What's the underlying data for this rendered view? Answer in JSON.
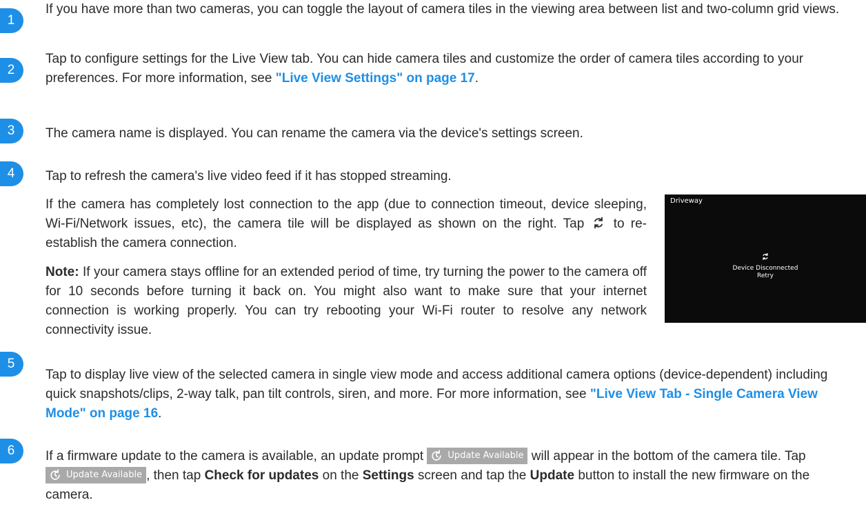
{
  "items": [
    {
      "number": "1",
      "text": "If you have more than two cameras, you can toggle the layout of camera tiles in the viewing area between list and two-column grid views."
    },
    {
      "number": "2",
      "text_before": "Tap to configure settings for the Live View tab. You can hide camera tiles and customize the order of camera tiles according to your preferences. For more information, see ",
      "link": "\"Live View Settings\" on page 17",
      "text_after": "."
    },
    {
      "number": "3",
      "text": "The camera name is displayed. You can rename the camera via the device's settings screen."
    },
    {
      "number": "4",
      "line1": "Tap to refresh the camera's live video feed if it has stopped streaming.",
      "para2_before": "If the camera has completely lost connection to the app (due to connection timeout, device sleeping, Wi-Fi/Network issues, etc), the camera tile will be displayed as shown on the right. Tap",
      "para2_after": "to re-establish the camera connection.",
      "note_label": "Note:",
      "note_text": " If your camera stays offline for an extended period of time, try turning the power to the camera off for 10 seconds before turning it back on. You might also want to make sure that your internet connection is working properly. You can try rebooting your Wi-Fi router to resolve any network connectivity issue."
    },
    {
      "number": "5",
      "text_before": "Tap to display live view of the selected camera in single view mode and access additional camera options (device-dependent) including quick snapshots/clips, 2-way talk, pan tilt controls, siren, and more. For more information, see ",
      "link": "\"Live View Tab - Single Camera View Mode\" on page 16",
      "text_after": "."
    },
    {
      "number": "6",
      "t1": "If a firmware update to the camera is available, an update prompt",
      "t2": "will appear in the bottom of the camera tile. Tap",
      "t3": ", then tap ",
      "b1": "Check for updates",
      "t4": " on the ",
      "b2": "Settings",
      "t5": " screen and tap the ",
      "b3": "Update",
      "t6": " button to install the new firmware on the camera."
    }
  ],
  "update_pill": {
    "label": "Update Available",
    "icon": "update-icon",
    "color": "#a9a9a9"
  },
  "camera_tile": {
    "name": "Driveway",
    "status": "Device Disconnected",
    "retry": "Retry",
    "icon": "refresh-icon"
  },
  "accent_color": "#1e8fe6"
}
